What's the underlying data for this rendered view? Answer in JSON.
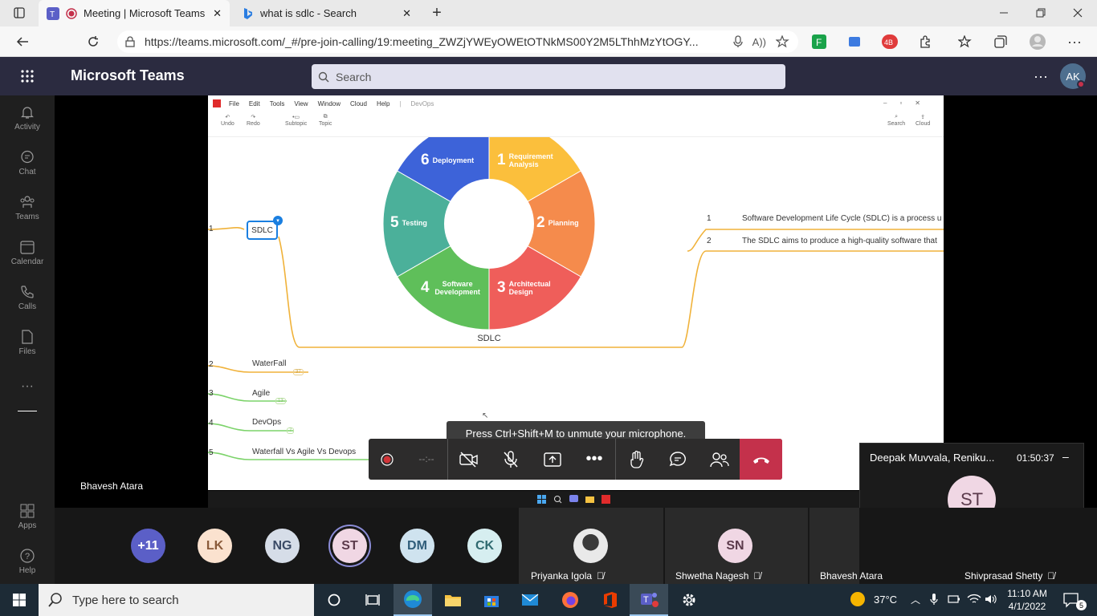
{
  "browser": {
    "tabs": [
      {
        "title": "Meeting | Microsoft Teams"
      },
      {
        "title": "what is sdlc - Search"
      }
    ],
    "url": "https://teams.microsoft.com/_#/pre-join-calling/19:meeting_ZWZjYWEyOWEtOTNkMS00Y2M5LThhMzYtOGY..."
  },
  "teams": {
    "app_name": "Microsoft Teams",
    "search_placeholder": "Search",
    "user_initials": "AK",
    "rail": [
      "Activity",
      "Chat",
      "Teams",
      "Calendar",
      "Calls",
      "Files",
      "Apps",
      "Help"
    ]
  },
  "shared_screen": {
    "presenter": "Bhavesh Atara",
    "xmind_menu": [
      "File",
      "Edit",
      "Tools",
      "View",
      "Window",
      "Cloud",
      "Help"
    ],
    "xmind_doc": "DevOps",
    "toolbar": {
      "undo": "Undo",
      "redo": "Redo",
      "subtopic": "Subtopic",
      "topic": "Topic",
      "search": "Search",
      "cloud": "Cloud"
    },
    "diagram": {
      "center_label": "SDLC",
      "segments": [
        {
          "num": "1",
          "label": "Requirement Analysis",
          "color": "#fbbf3c"
        },
        {
          "num": "2",
          "label": "Planning",
          "color": "#f58b4c"
        },
        {
          "num": "3",
          "label": "Architectual Design",
          "color": "#ef5e5a"
        },
        {
          "num": "4",
          "label": "Software Development",
          "color": "#5fbf5a"
        },
        {
          "num": "5",
          "label": "Testing",
          "color": "#4bb09a"
        },
        {
          "num": "6",
          "label": "Deployment",
          "color": "#3d63d9"
        }
      ]
    },
    "node_sdlc": {
      "num": "1",
      "label": "SDLC"
    },
    "notes": [
      {
        "num": "1",
        "text": "Software Development Life Cycle (SDLC) is a process u"
      },
      {
        "num": "2",
        "text": "The SDLC aims to produce a high-quality software that"
      }
    ],
    "branches": [
      {
        "num": "2",
        "label": "WaterFall",
        "badge": "37"
      },
      {
        "num": "3",
        "label": "Agile",
        "badge": "13"
      },
      {
        "num": "4",
        "label": "DevOps",
        "badge": "7"
      },
      {
        "num": "5",
        "label": "Waterfall Vs Agile Vs Devops",
        "badge": ""
      }
    ]
  },
  "call": {
    "tooltip": "Press Ctrl+Shift+M to unmute your microphone.",
    "timer": "--:--",
    "popout": {
      "name": "Deepak Muvvala, Reniku...",
      "time": "01:50:37",
      "initials": "ST"
    }
  },
  "gallery": {
    "avatars": [
      {
        "initials": "+11",
        "bg": "#5b5fc7",
        "fg": "#ffffff"
      },
      {
        "initials": "LK",
        "bg": "#fbe2cf",
        "fg": "#8a5a3a"
      },
      {
        "initials": "NG",
        "bg": "#d6dde8",
        "fg": "#3a4a66"
      },
      {
        "initials": "ST",
        "bg": "#f0d7e4",
        "fg": "#5c3b4c"
      },
      {
        "initials": "DM",
        "bg": "#cfe3ef",
        "fg": "#2f5d7a"
      },
      {
        "initials": "CK",
        "bg": "#d6eef0",
        "fg": "#2f6a70"
      }
    ],
    "tiles": [
      {
        "name": "Priyanka Igola"
      },
      {
        "name": "Shwetha Nagesh",
        "initials": "SN"
      },
      {
        "name": "Bhavesh Atara"
      },
      {
        "name": "Shivprasad Shetty"
      }
    ]
  },
  "taskbar": {
    "search_placeholder": "Type here to search",
    "temperature": "37°C",
    "time": "11:10 AM",
    "date": "4/1/2022",
    "notifications": "5"
  }
}
